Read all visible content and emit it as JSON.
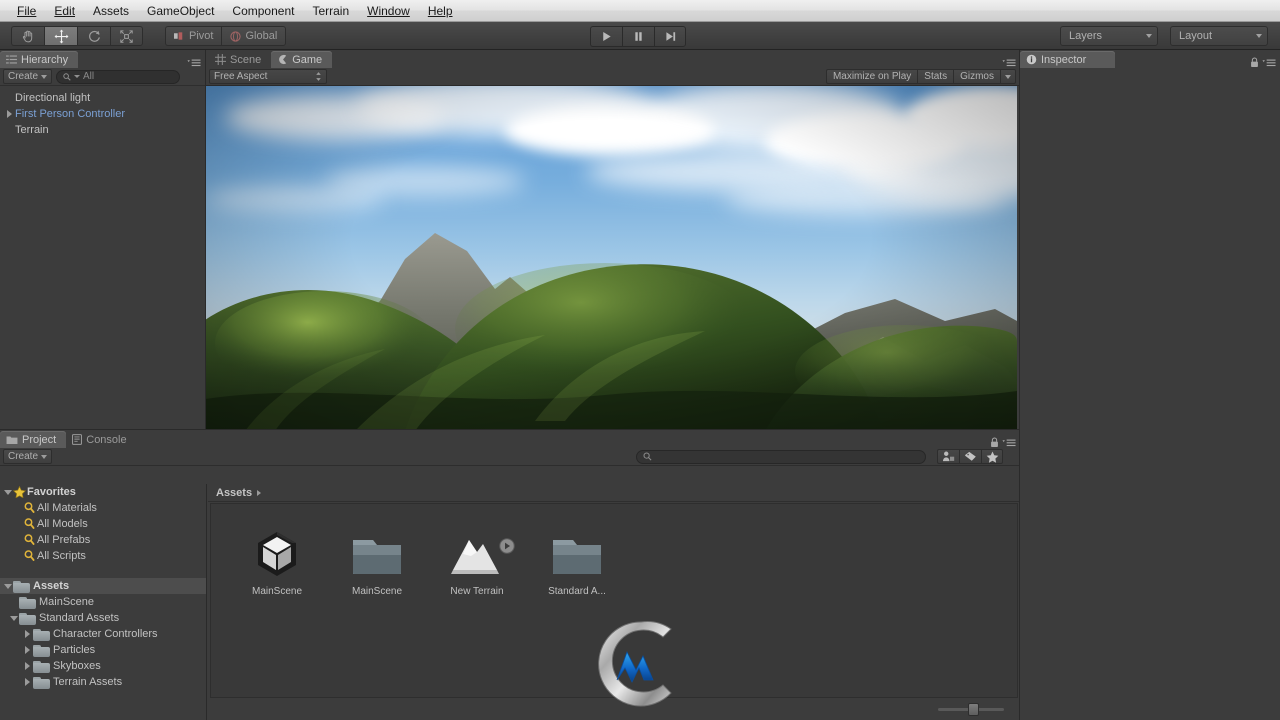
{
  "menu": {
    "items": [
      "File",
      "Edit",
      "Assets",
      "GameObject",
      "Component",
      "Terrain",
      "Window",
      "Help"
    ]
  },
  "toolbar": {
    "tools": [
      {
        "name": "hand-tool",
        "label": "Hand"
      },
      {
        "name": "move-tool",
        "label": "Move"
      },
      {
        "name": "rotate-tool",
        "label": "Rotate"
      },
      {
        "name": "scale-tool",
        "label": "Scale"
      }
    ],
    "pivot_label": "Pivot",
    "global_label": "Global",
    "play_label": "Play",
    "pause_label": "Pause",
    "step_label": "Step",
    "layers_label": "Layers",
    "layout_label": "Layout"
  },
  "hierarchy": {
    "tab_label": "Hierarchy",
    "create_label": "Create",
    "search_placeholder": "All",
    "items": [
      {
        "label": "Directional light",
        "expandable": false,
        "selected": false
      },
      {
        "label": "First Person Controller",
        "expandable": true,
        "selected": true
      },
      {
        "label": "Terrain",
        "expandable": false,
        "selected": false
      }
    ]
  },
  "gameview": {
    "tabs": [
      {
        "label": "Scene",
        "active": false,
        "icon": "grid-icon"
      },
      {
        "label": "Game",
        "active": true,
        "icon": "gamepad-icon"
      }
    ],
    "aspect_label": "Free Aspect",
    "maximize_label": "Maximize on Play",
    "stats_label": "Stats",
    "gizmos_label": "Gizmos",
    "scene_description": "3D terrain render: green grassy hills and rocky gray mountain peaks under a blue sky with white clouds"
  },
  "inspector": {
    "tab_label": "Inspector",
    "lock_icon": "lock-icon",
    "menu_icon": "hamburger-icon"
  },
  "project": {
    "tabs": [
      {
        "label": "Project",
        "active": true,
        "icon": "folder-icon"
      },
      {
        "label": "Console",
        "active": false,
        "icon": "console-icon"
      }
    ],
    "create_label": "Create",
    "search_value": "",
    "filter_icons": [
      "asset-type-filter-icon",
      "label-filter-icon",
      "favorite-filter-icon"
    ],
    "breadcrumb": "Assets",
    "tree": [
      {
        "label": "Favorites",
        "depth": 0,
        "expanded": true,
        "icon": "star-icon",
        "bold": true
      },
      {
        "label": "All Materials",
        "depth": 1,
        "icon": "search-icon"
      },
      {
        "label": "All Models",
        "depth": 1,
        "icon": "search-icon"
      },
      {
        "label": "All Prefabs",
        "depth": 1,
        "icon": "search-icon"
      },
      {
        "label": "All Scripts",
        "depth": 1,
        "icon": "search-icon"
      },
      {
        "label": "Assets",
        "depth": 0,
        "expanded": true,
        "icon": "folder-icon",
        "bold": true,
        "highlighted": true
      },
      {
        "label": "MainScene",
        "depth": 1,
        "icon": "folder-icon"
      },
      {
        "label": "Standard Assets",
        "depth": 1,
        "expanded": true,
        "icon": "folder-icon"
      },
      {
        "label": "Character Controllers",
        "depth": 2,
        "collapsed": true,
        "icon": "folder-icon"
      },
      {
        "label": "Particles",
        "depth": 2,
        "collapsed": true,
        "icon": "folder-icon"
      },
      {
        "label": "Skyboxes",
        "depth": 2,
        "collapsed": true,
        "icon": "folder-icon"
      },
      {
        "label": "Terrain Assets",
        "depth": 2,
        "collapsed": true,
        "icon": "folder-icon"
      }
    ],
    "assets": [
      {
        "label": "MainScene",
        "icon": "unity-scene-icon"
      },
      {
        "label": "MainScene",
        "icon": "folder-icon"
      },
      {
        "label": "New Terrain",
        "icon": "terrain-icon",
        "has_preview_badge": true
      },
      {
        "label": "Standard A...",
        "icon": "folder-icon"
      }
    ],
    "zoom_slider_value": 45
  },
  "watermark": {
    "alt": "silver ring logo with blue M lettering"
  },
  "colors": {
    "panel_bg": "#3c3c3c",
    "tab_active": "#5a5a5a",
    "text": "#b4b4b4",
    "selected_text": "#7ba0d4",
    "menu_bar": "#e3e3e3",
    "folder": "#a8b0b3",
    "star": "#e8c33a"
  }
}
